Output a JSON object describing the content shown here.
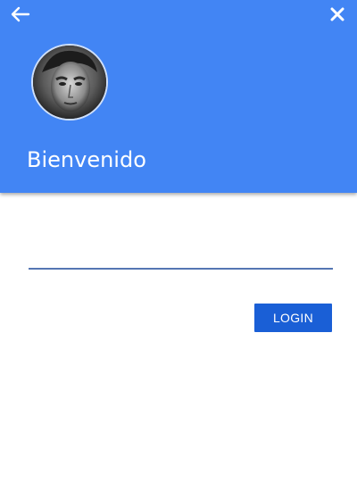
{
  "header": {
    "background": "#4285f4",
    "back_icon": "arrow-left-icon",
    "close_icon": "close-icon",
    "avatar": "profile-photo",
    "welcome_text": "Bienvenido"
  },
  "form": {
    "input_value": "",
    "input_placeholder": "",
    "login_label": "LOGIN",
    "button_color": "#1a5fd6",
    "underline_color": "#5576b3"
  }
}
